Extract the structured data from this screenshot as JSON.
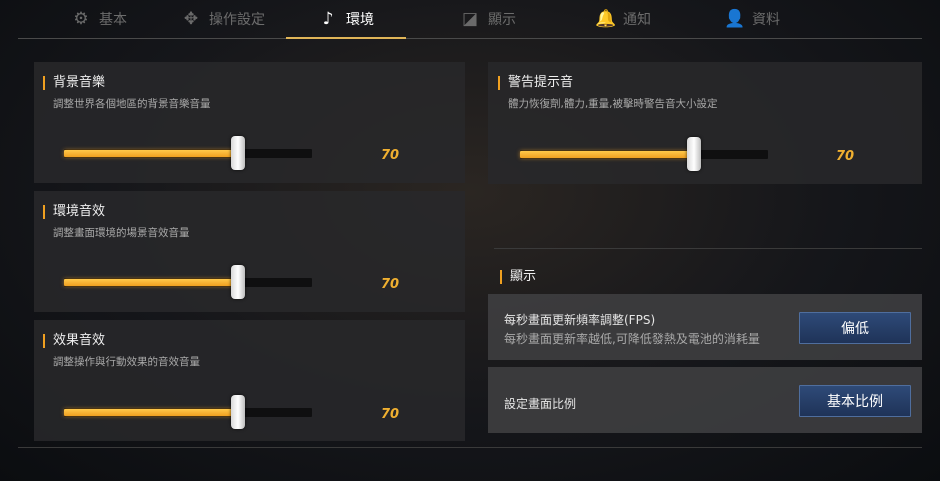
{
  "tabs": [
    {
      "label": "基本",
      "icon": "gear-icon",
      "glyph": "⚙"
    },
    {
      "label": "操作設定",
      "icon": "controller-icon",
      "glyph": "✥"
    },
    {
      "label": "環境",
      "icon": "music-note-icon",
      "glyph": "♪"
    },
    {
      "label": "顯示",
      "icon": "display-icon",
      "glyph": "◪"
    },
    {
      "label": "通知",
      "icon": "bell-icon",
      "glyph": "🔔"
    },
    {
      "label": "資料",
      "icon": "profile-icon",
      "glyph": "👤"
    }
  ],
  "active_tab": "環境",
  "accent_color": "#f0a020",
  "sliders": {
    "bgm": {
      "title": "背景音樂",
      "desc": "調整世界各個地區的背景音樂音量",
      "value": "70",
      "fraction": 0.7
    },
    "ambient": {
      "title": "環境音效",
      "desc": "調整畫面環境的場景音效音量",
      "value": "70",
      "fraction": 0.7
    },
    "effect": {
      "title": "效果音效",
      "desc": "調整操作與行動效果的音效音量",
      "value": "70",
      "fraction": 0.7
    },
    "warning": {
      "title": "警告提示音",
      "desc": "體力恢復劑,體力,重量,被擊時警告音大小設定",
      "value": "70",
      "fraction": 0.7
    }
  },
  "display": {
    "title": "顯示",
    "fps": {
      "label": "每秒畫面更新頻率調整(FPS)",
      "sub": "每秒畫面更新率越低,可降低發熱及電池的消耗量",
      "button": "偏低"
    },
    "ratio": {
      "label": "設定畫面比例",
      "button": "基本比例"
    }
  }
}
